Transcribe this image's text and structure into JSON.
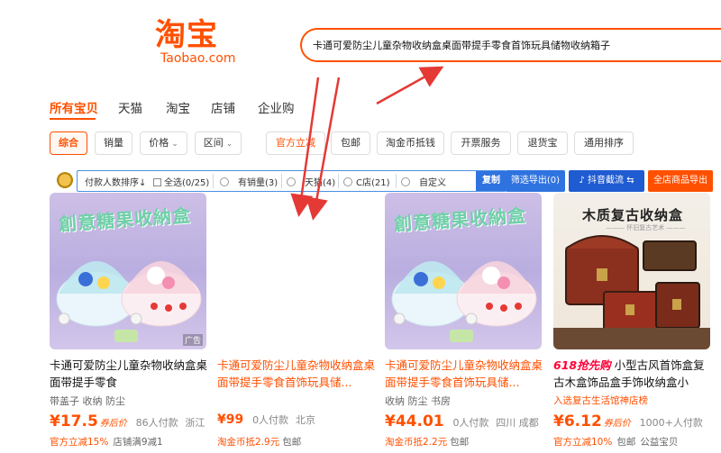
{
  "logo": {
    "cn": "淘宝",
    "en": "Taobao.com"
  },
  "search": {
    "query": "卡通可爱防尘儿童杂物收纳盒桌面带提手零食首饰玩具储物收纳箱子"
  },
  "tabs": [
    "所有宝贝",
    "天猫",
    "淘宝",
    "店铺",
    "企业购"
  ],
  "filters": {
    "sort": "综合",
    "sales": "销量",
    "price": "价格",
    "region": "区间",
    "official": "官方立减",
    "free_ship": "包邮",
    "coin": "淘金币抵钱",
    "invoice": "开票服务",
    "return": "退货宝",
    "general_sort": "通用排序"
  },
  "toolbar": {
    "sort_label": "付款人数排序↓",
    "select_all": "全选(0/25)",
    "has_sales": "有销量(3)",
    "tmall": "天猫(4)",
    "c_shop": "C店(21)",
    "custom": "自定义",
    "copy": "复制",
    "filter_export": "筛选导出(0)",
    "douyin": "抖音截流",
    "all_export": "全店商品导出"
  },
  "products": [
    {
      "img_title": "創意糖果收納盒",
      "title": "卡通可爱防尘儿童杂物收纳盒桌面带提手零食",
      "tags": "带盖子  收纳  防尘",
      "price": "¥17.5",
      "coupon": "券后价",
      "sold": "86人付款",
      "location": "浙江",
      "promo": "官方立减15%",
      "promo_extra": "店铺满9减1",
      "ad": "广告"
    },
    {
      "title": "卡通可爱防尘儿童杂物收纳盒桌面带提手零食首饰玩具储...",
      "price": "¥99",
      "sold": "0人付款",
      "location": "北京",
      "promo": "淘金币抵2.9元",
      "promo_extra": "包邮"
    },
    {
      "img_title": "創意糖果收納盒",
      "title": "卡通可爱防尘儿童杂物收纳盒桌面带提手零食首饰玩具储...",
      "tags": "收纳  防尘  书房",
      "price": "¥44.01",
      "sold": "0人付款",
      "location": "四川 成都",
      "promo": "淘金币抵2.2元",
      "promo_extra": "包邮"
    },
    {
      "img_title": "木质复古收纳盒",
      "img_sub": "——— 怀旧复古艺术 ———",
      "title_badge": "618抢先购",
      "title": "小型古风首饰盒复古木盒饰品盒手饰收纳盒小",
      "shop": "入选复古生活馆神店榜",
      "price": "¥6.12",
      "coupon": "券后价",
      "sold": "1000+人付款",
      "promo": "官方立减10%",
      "promo_extra": "包邮",
      "promo_extra2": "公益宝贝"
    }
  ],
  "colors": {
    "accent": "#ff5000",
    "highlight": "#ff0036",
    "toolbar_blue": "#2f73e0",
    "annotation": "#e53935"
  }
}
